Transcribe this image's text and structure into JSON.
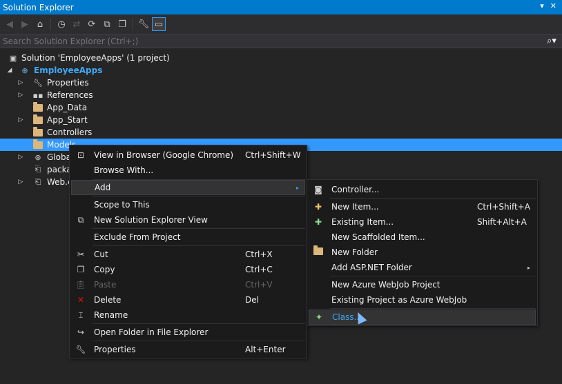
{
  "title": "Solution Explorer",
  "title_controls": [
    "▾",
    "✕"
  ],
  "toolbar": {
    "icons": [
      "back-icon",
      "forward-icon",
      "home-icon",
      "history-icon",
      "sync-icon",
      "refresh-icon",
      "collapse-icon",
      "copy-icon",
      "properties-icon",
      "preview-icon"
    ]
  },
  "search": {
    "placeholder": "Search Solution Explorer (Ctrl+;)"
  },
  "tree": {
    "solution": "Solution 'EmployeeApps' (1 project)",
    "project": "EmployeeApps",
    "items": [
      {
        "label": "Properties"
      },
      {
        "label": "References"
      },
      {
        "label": "App_Data"
      },
      {
        "label": "App_Start"
      },
      {
        "label": "Controllers"
      },
      {
        "label": "Models"
      },
      {
        "label": "Globa"
      },
      {
        "label": "packa"
      },
      {
        "label": "Web.c"
      }
    ]
  },
  "context_menu": {
    "items": [
      {
        "label": "View in Browser (Google Chrome)",
        "shortcut": "Ctrl+Shift+W"
      },
      {
        "label": "Browse With..."
      },
      {
        "label": "Add",
        "submenu": "▸"
      },
      {
        "label": "Scope to This"
      },
      {
        "label": "New Solution Explorer View"
      },
      {
        "label": "Exclude From Project"
      },
      {
        "label": "Cut",
        "shortcut": "Ctrl+X"
      },
      {
        "label": "Copy",
        "shortcut": "Ctrl+C"
      },
      {
        "label": "Paste",
        "shortcut": "Ctrl+V"
      },
      {
        "label": "Delete",
        "shortcut": "Del"
      },
      {
        "label": "Rename"
      },
      {
        "label": "Open Folder in File Explorer"
      },
      {
        "label": "Properties",
        "shortcut": "Alt+Enter"
      }
    ]
  },
  "add_menu": {
    "items": [
      {
        "label": "Controller..."
      },
      {
        "label": "New Item...",
        "shortcut": "Ctrl+Shift+A"
      },
      {
        "label": "Existing Item...",
        "shortcut": "Shift+Alt+A"
      },
      {
        "label": "New Scaffolded Item..."
      },
      {
        "label": "New Folder"
      },
      {
        "label": "Add ASP.NET Folder",
        "submenu": "▸"
      },
      {
        "label": "New Azure WebJob Project"
      },
      {
        "label": "Existing Project as Azure WebJob"
      },
      {
        "label": "Class..."
      }
    ]
  },
  "colors": {
    "accent": "#007acc",
    "selection": "#3399ff",
    "background": "#252526",
    "folder": "#dcb67a"
  }
}
